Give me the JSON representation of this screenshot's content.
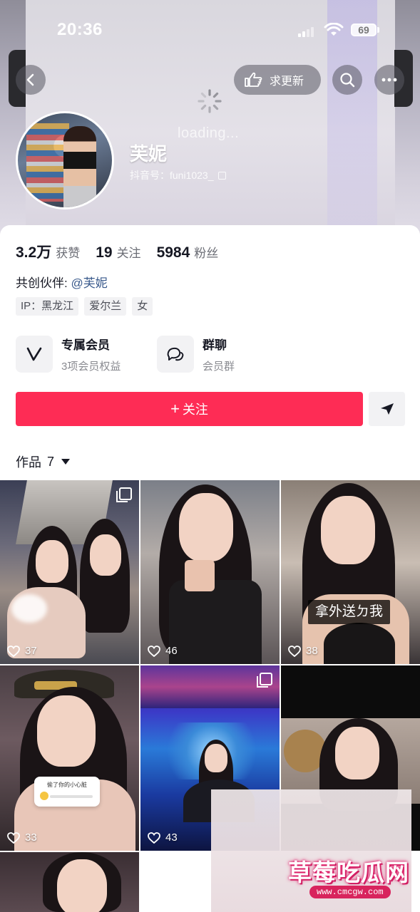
{
  "status_bar": {
    "time": "20:36",
    "battery": "69"
  },
  "header": {
    "request_update_label": "求更新",
    "loading_text": "loading...",
    "profile_name": "芙妮",
    "douyin_id": "抖音号：funi1023_"
  },
  "stats": [
    {
      "value": "3.2万",
      "label": "获赞"
    },
    {
      "value": "19",
      "label": "关注"
    },
    {
      "value": "5984",
      "label": "粉丝"
    }
  ],
  "partner": {
    "prefix": "共创伙伴:",
    "link": "@芙妮"
  },
  "tags": [
    "IP：黑龙江",
    "爱尔兰",
    "女"
  ],
  "features": [
    {
      "title": "专属会员",
      "subtitle": "3项会员权益",
      "icon": "vip-v-icon"
    },
    {
      "title": "群聊",
      "subtitle": "会员群",
      "icon": "group-chat-icon"
    }
  ],
  "actions": {
    "follow_label": "关注"
  },
  "works": {
    "label": "作品",
    "count": "7"
  },
  "grid": [
    {
      "likes": "37",
      "multi": true
    },
    {
      "likes": "46",
      "multi": false
    },
    {
      "likes": "38",
      "multi": false,
      "caption": "拿外送ㄉ我"
    },
    {
      "likes": "33",
      "multi": false,
      "sticker": "偷了你的小心脏"
    },
    {
      "likes": "43",
      "multi": true
    },
    {
      "likes": "",
      "multi": false
    }
  ],
  "watermark": {
    "text": "草莓吃瓜网",
    "url": "www.cmcgw.com"
  },
  "colors": {
    "primary_red": "#fe2c55",
    "link_blue": "#3a5a8c",
    "watermark_pink": "#d8245d"
  }
}
